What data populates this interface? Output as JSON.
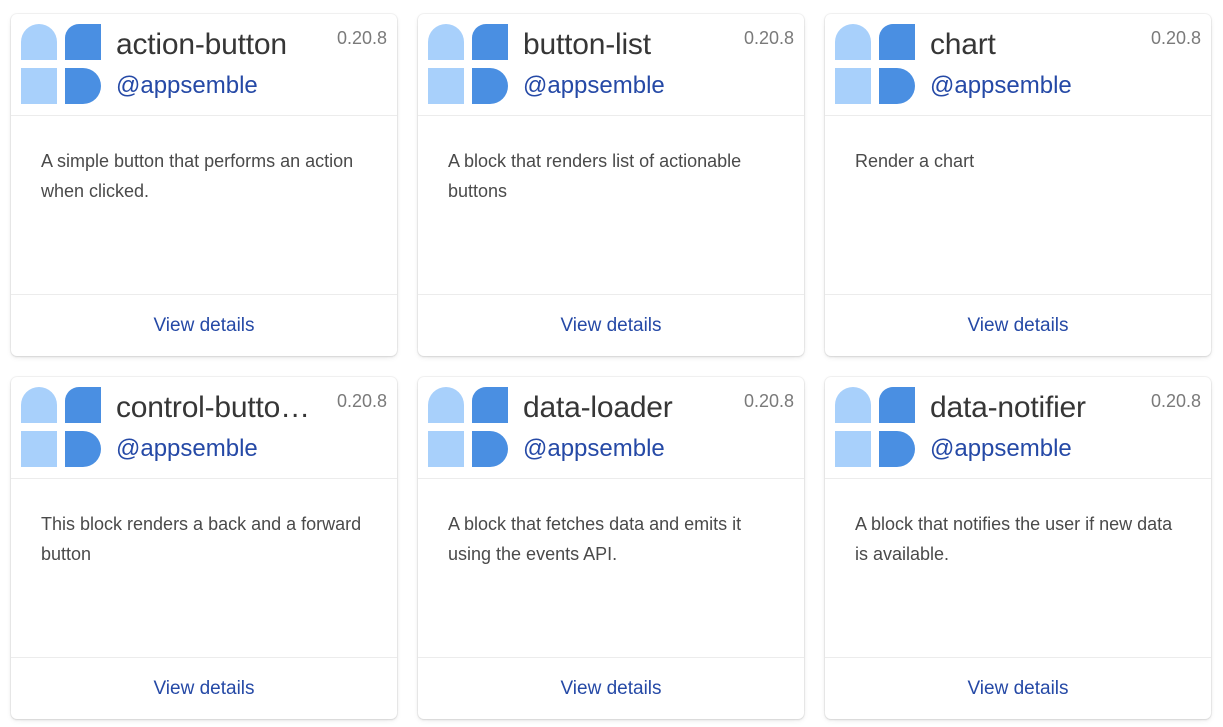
{
  "colors": {
    "logo_light": "#a8d0fb",
    "logo_dark": "#4a8fe2",
    "link": "#2549a6",
    "title": "#363636",
    "muted": "#7a7a7a"
  },
  "cards": [
    {
      "title": "action-button",
      "org": "@appsemble",
      "version": "0.20.8",
      "description": "A simple button that performs an action when clicked.",
      "link_label": "View details",
      "icon": "appsemble-logo-icon"
    },
    {
      "title": "button-list",
      "org": "@appsemble",
      "version": "0.20.8",
      "description": "A block that renders list of actionable buttons",
      "link_label": "View details",
      "icon": "appsemble-logo-icon"
    },
    {
      "title": "chart",
      "org": "@appsemble",
      "version": "0.20.8",
      "description": "Render a chart",
      "link_label": "View details",
      "icon": "appsemble-logo-icon"
    },
    {
      "title": "control-butto…",
      "org": "@appsemble",
      "version": "0.20.8",
      "description": "This block renders a back and a forward button",
      "link_label": "View details",
      "icon": "appsemble-logo-icon"
    },
    {
      "title": "data-loader",
      "org": "@appsemble",
      "version": "0.20.8",
      "description": "A block that fetches data and emits it using the events API.",
      "link_label": "View details",
      "icon": "appsemble-logo-icon"
    },
    {
      "title": "data-notifier",
      "org": "@appsemble",
      "version": "0.20.8",
      "description": "A block that notifies the user if new data is available.",
      "link_label": "View details",
      "icon": "appsemble-logo-icon"
    }
  ]
}
